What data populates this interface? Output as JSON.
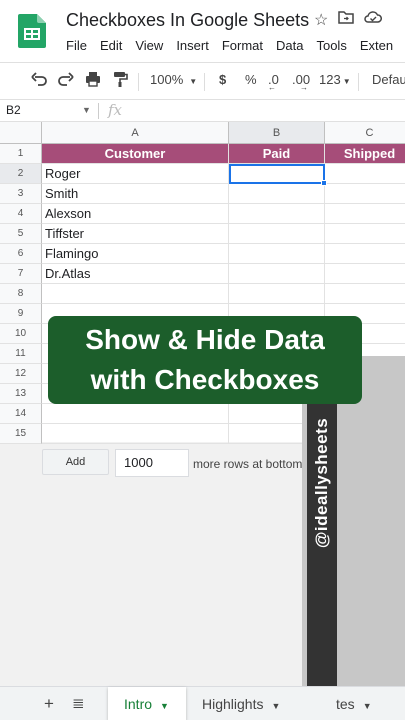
{
  "window": {
    "title": "Checkboxes In Google Sheets",
    "menu": [
      "File",
      "Edit",
      "View",
      "Insert",
      "Format",
      "Data",
      "Tools",
      "Exten"
    ]
  },
  "toolbar": {
    "zoom": "100%",
    "currency": "$",
    "percent": "%",
    "decrease_decimals": ".0",
    "increase_decimals": ".00",
    "number_format": "123",
    "font": "Defaul"
  },
  "formula_bar": {
    "cell_ref": "B2",
    "fx": "fx"
  },
  "columns": [
    "A",
    "B",
    "C"
  ],
  "rows": [
    "1",
    "2",
    "3",
    "4",
    "5",
    "6",
    "7",
    "8",
    "9",
    "10",
    "11",
    "12",
    "13",
    "14",
    "15"
  ],
  "header": {
    "customer": "Customer",
    "paid": "Paid",
    "shipped": "Shipped"
  },
  "customers": [
    "Roger",
    "Smith",
    "Alexson",
    "Tiffster",
    "Flamingo",
    "Dr.Atlas"
  ],
  "add_rows": {
    "button": "Add",
    "count": "1000",
    "label": "more rows at bottom."
  },
  "overlay": {
    "line1": "Show & Hide Data",
    "line2": "with Checkboxes"
  },
  "watermark": "@ideallysheets",
  "sheet_tabs": {
    "tabs": [
      "Intro",
      "Highlights",
      "tes"
    ],
    "active": "Intro"
  },
  "colors": {
    "header_bg": "#a64d79",
    "overlay_bg": "#1c5e2b",
    "selection": "#1a73e8",
    "active_tab": "#188038"
  }
}
